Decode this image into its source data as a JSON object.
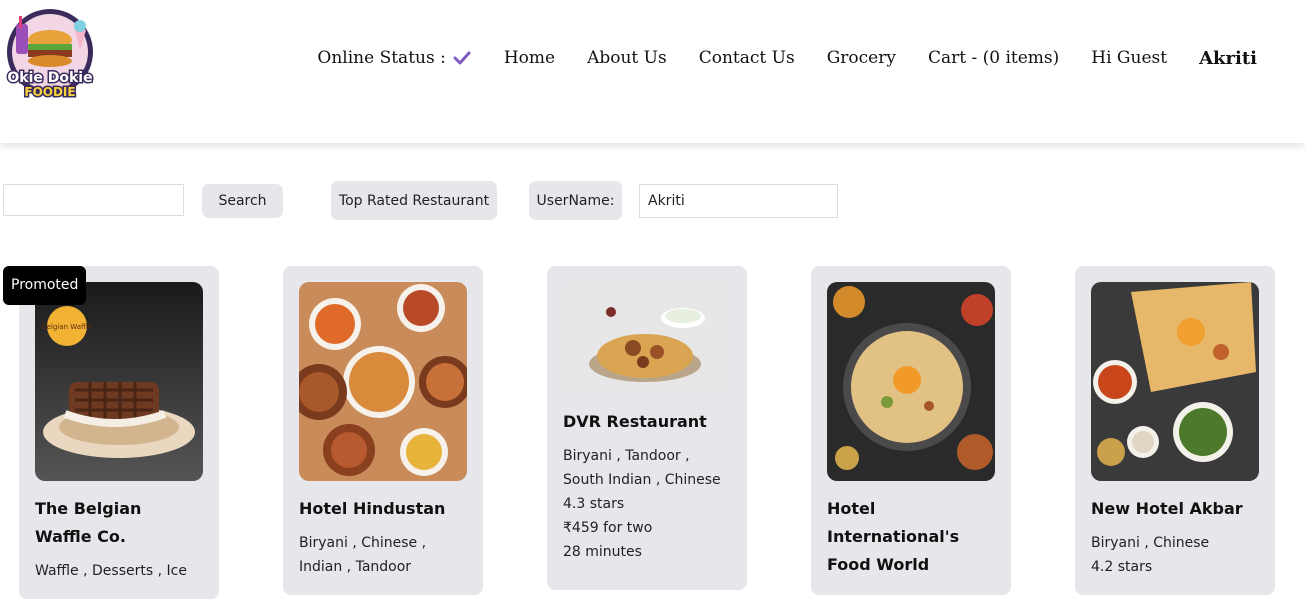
{
  "header": {
    "logo": {
      "line1": "Okie Dokie",
      "line2": "FOODIE"
    },
    "nav": {
      "online_status": "Online Status :",
      "online_icon": "check-icon",
      "home": "Home",
      "about": "About Us",
      "contact": "Contact Us",
      "grocery": "Grocery",
      "cart": "Cart - (0 items)",
      "greeting": "Hi Guest",
      "user": "Akriti"
    }
  },
  "controls": {
    "search_value": "",
    "search_button": "Search",
    "top_rated_button": "Top Rated Restaurant",
    "username_label": "UserName:",
    "username_value": "Akriti"
  },
  "restaurants": [
    {
      "promoted_label": "Promoted",
      "name": "The Belgian Waffle Co.",
      "cuisines": "Waffle , Desserts , Ice",
      "image": "waffle-photo",
      "badge_text": "Belgian Waffle"
    },
    {
      "name": "Hotel Hindustan",
      "cuisines": "Biryani , Chinese , Indian , Tandoor",
      "image": "biryani-spread-photo"
    },
    {
      "name": "DVR Restaurant",
      "cuisines": "Biryani , Tandoor , South Indian , Chinese",
      "rating": "4.3 stars",
      "cost": "₹459 for two",
      "time": "28 minutes",
      "image": "biryani-plate-photo"
    },
    {
      "name": "Hotel International's Food World",
      "image": "biryani-platter-photo"
    },
    {
      "name": "New Hotel Akbar",
      "cuisines": "Biryani , Chinese",
      "rating": "4.2 stars",
      "image": "naan-curry-photo"
    }
  ],
  "colors": {
    "accent": "#7c5cc4",
    "card_bg": "#e5e7eb",
    "promoted_bg": "#000000"
  }
}
